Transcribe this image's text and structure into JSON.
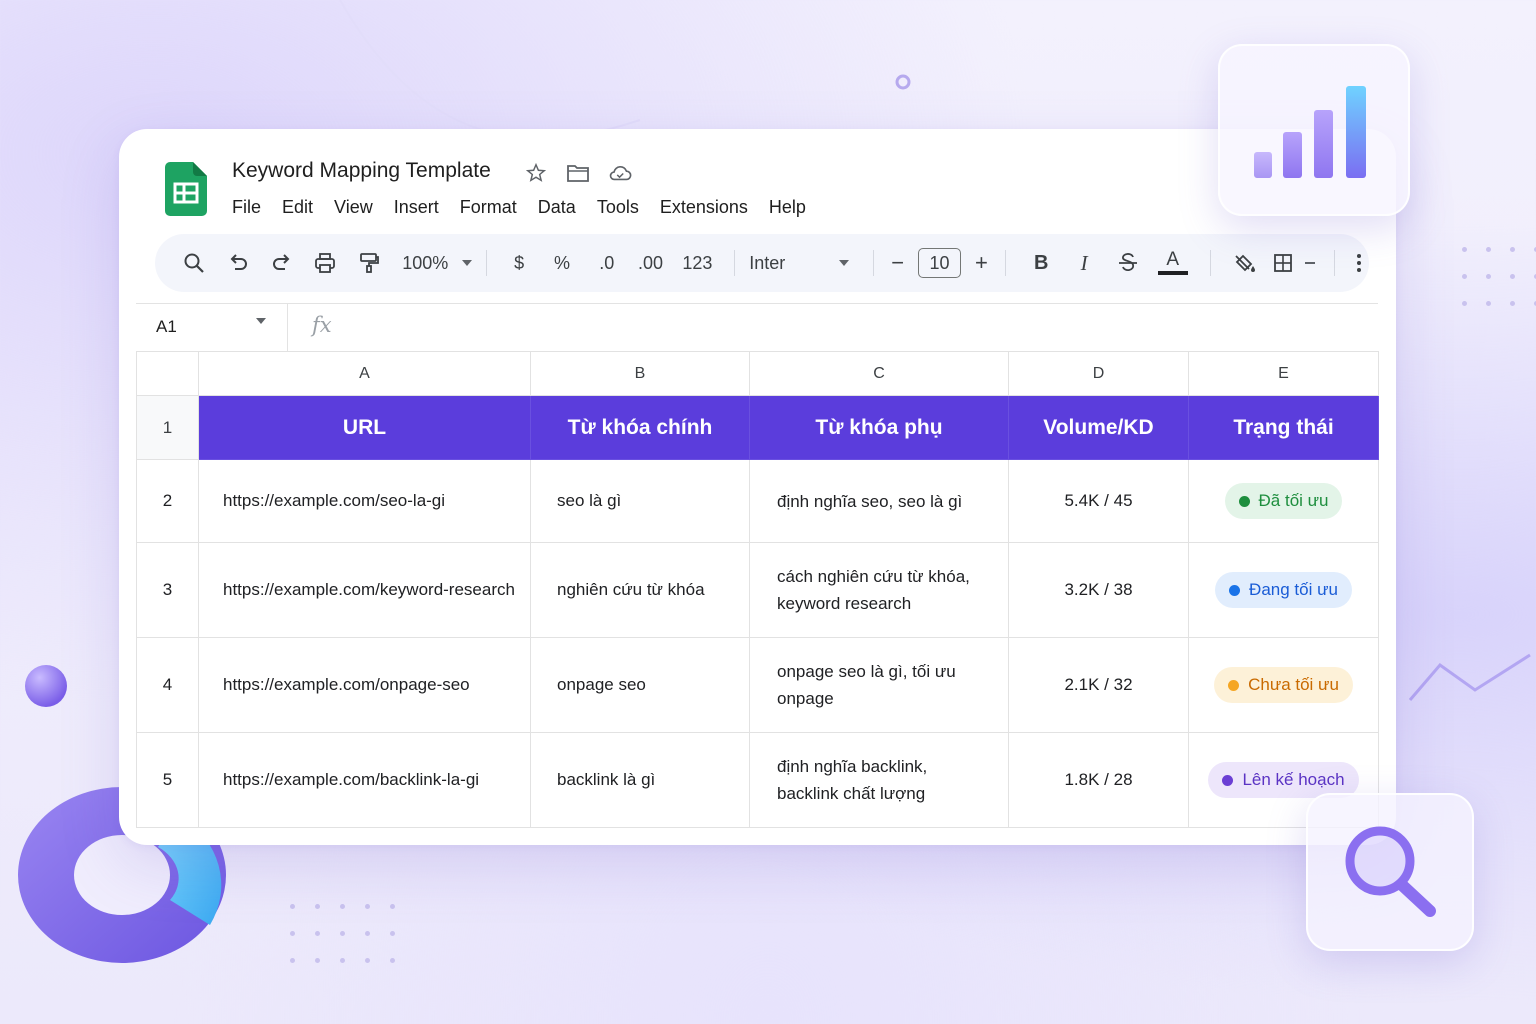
{
  "app": {
    "title": "Keyword Mapping Template",
    "menu": [
      "File",
      "Edit",
      "View",
      "Insert",
      "Format",
      "Data",
      "Tools",
      "Extensions",
      "Help"
    ]
  },
  "toolbar": {
    "zoom": "100%",
    "currency": "$",
    "percent": "%",
    "decrease_decimal": ".0",
    "increase_decimal": ".00",
    "number_format": "123",
    "font": "Inter",
    "font_size": "10",
    "minus": "−",
    "plus": "+",
    "bold": "B",
    "italic": "I",
    "text_color": "A"
  },
  "formula_bar": {
    "cell_ref": "A1",
    "fx": "fx"
  },
  "sheet": {
    "columns": [
      "A",
      "B",
      "C",
      "D",
      "E"
    ],
    "header_row": [
      "URL",
      "Từ khóa chính",
      "Từ khóa phụ",
      "Volume/KD",
      "Trạng thái"
    ],
    "rows": [
      {
        "num": "1"
      },
      {
        "num": "2",
        "url": "https://example.com/seo-la-gi",
        "main_kw": "seo là gì",
        "sub_kw": "định nghĩa seo, seo là gì",
        "volume": "5.4K / 45",
        "status": "Đã tối ưu"
      },
      {
        "num": "3",
        "url": "https://example.com/keyword-research",
        "main_kw": "nghiên cứu từ khóa",
        "sub_kw_1": "cách nghiên cứu từ khóa,",
        "sub_kw_2": "keyword research",
        "volume": "3.2K / 38",
        "status": "Đang tối ưu"
      },
      {
        "num": "4",
        "url": "https://example.com/onpage-seo",
        "main_kw": "onpage seo",
        "sub_kw_1": "onpage seo là gì, tối ưu",
        "sub_kw_2": "onpage",
        "volume": "2.1K / 32",
        "status": "Chưa tối ưu"
      },
      {
        "num": "5",
        "url": "https://example.com/backlink-la-gi",
        "main_kw": "backlink là gì",
        "sub_kw_1": "định nghĩa backlink,",
        "sub_kw_2": "backlink chất lượng",
        "volume": "1.8K / 28",
        "status": "Lên kế hoạch"
      }
    ]
  },
  "colors": {
    "header_bg": "#5b3ddc",
    "link": "#1a55d6",
    "status_done": "#1e8e3e",
    "status_in_progress": "#1a73e8",
    "status_not_done": "#e37400",
    "status_planned": "#6b3fd4",
    "sheets_green": "#188038"
  },
  "icons": {
    "search": "search-icon",
    "undo": "undo-icon",
    "redo": "redo-icon",
    "print": "print-icon",
    "paint_format": "paint-format-icon",
    "star": "star-icon",
    "folder": "folder-icon",
    "cloud": "cloud-icon"
  }
}
